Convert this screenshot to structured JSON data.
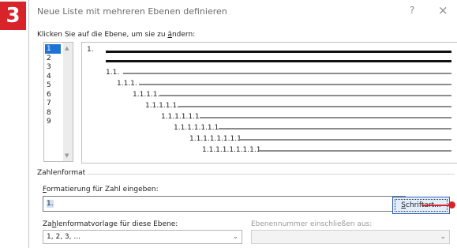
{
  "step_badge": "3",
  "dialog": {
    "title": "Neue Liste mit mehreren Ebenen definieren",
    "help_label": "?",
    "close_label": "×",
    "instruction_prefix": "Klicken Sie auf die Ebene, um sie zu ",
    "instruction_underlined": "ä",
    "instruction_suffix": "ndern:"
  },
  "levels": [
    "1",
    "2",
    "3",
    "4",
    "5",
    "6",
    "7",
    "8",
    "9"
  ],
  "selected_level": "1",
  "icons": {
    "scroll_up": "▲",
    "scroll_down": "▼",
    "dropdown": "⌄"
  },
  "preview_labels": [
    "1.",
    "1.1.",
    "1.1.1.",
    "1.1.1.1.",
    "1.1.1.1.1.",
    "1.1.1.1.1.1.",
    "1.1.1.1.1.1.1.",
    "1.1.1.1.1.1.1.1.",
    "1.1.1.1.1.1.1.1.1."
  ],
  "number_format": {
    "section_title": "Zahlenformat",
    "format_label_underlined": "F",
    "format_label_rest": "ormatierung für Zahl eingeben:",
    "format_value": "1.",
    "font_button_underlined": "S",
    "font_button_rest": "chriftart...",
    "style_label_prefix": "Za",
    "style_label_underlined": "h",
    "style_label_suffix": "lenformatvorlage für diese Ebene:",
    "style_value": "1, 2, 3, ...",
    "include_label": "Ebenennummer einschließen aus:",
    "include_value": ""
  },
  "colors": {
    "accent_red": "#d8232a",
    "selection_blue": "#1e73d6"
  }
}
